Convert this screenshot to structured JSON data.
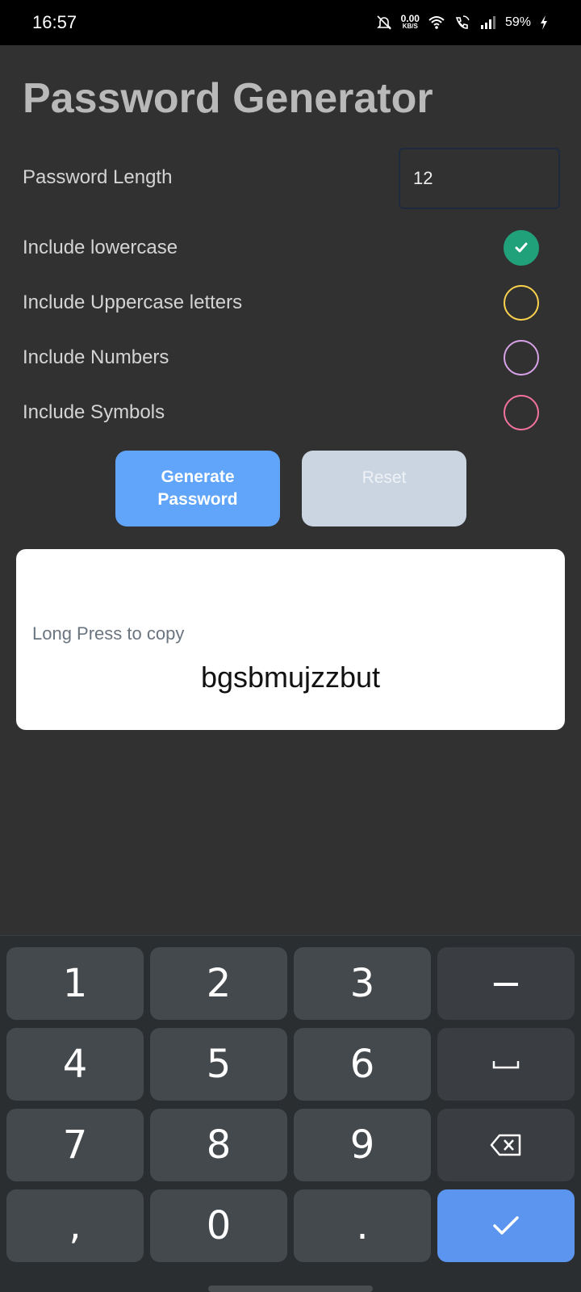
{
  "status_bar": {
    "time": "16:57",
    "net_speed_value": "0.00",
    "net_speed_unit": "KB/S",
    "battery": "59%",
    "icons": [
      "mute-bell-icon",
      "wifi-icon",
      "wifi-call-icon",
      "signal-icon",
      "charging-icon"
    ]
  },
  "app": {
    "title": "Password Generator",
    "length_label": "Password Length",
    "length_value": "12",
    "options": [
      {
        "label": "Include lowercase",
        "checked": true,
        "color": "#21a179"
      },
      {
        "label": "Include Uppercase letters",
        "checked": false,
        "color": "#fbd24e"
      },
      {
        "label": "Include Numbers",
        "checked": false,
        "color": "#d8a2e8"
      },
      {
        "label": "Include Symbols",
        "checked": false,
        "color": "#f472a0"
      }
    ],
    "generate_label": "Generate Password",
    "reset_label": "Reset",
    "result_hint": "Long Press to copy",
    "result_password": "bgsbmujzzbut"
  },
  "keyboard": {
    "rows": [
      [
        "1",
        "2",
        "3",
        "−"
      ],
      [
        "4",
        "5",
        "6",
        "space"
      ],
      [
        "7",
        "8",
        "9",
        "backspace"
      ],
      [
        ",",
        "0",
        ".",
        "enter"
      ]
    ],
    "accent_color": "#5b95f0"
  }
}
